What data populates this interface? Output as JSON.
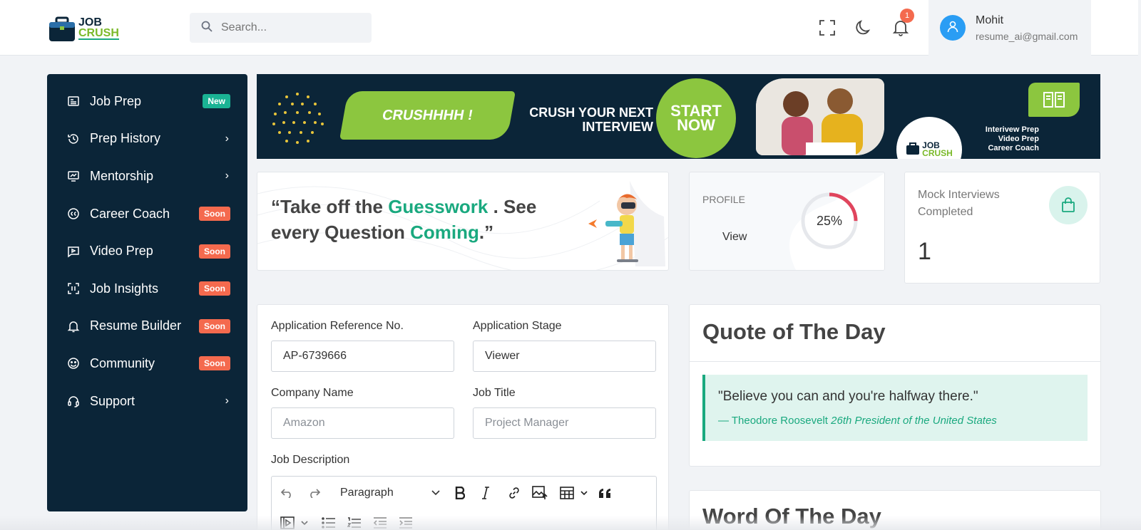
{
  "header": {
    "logo_line1": "JOB",
    "logo_line2": "CRUSH",
    "search_placeholder": "Search...",
    "notification_count": "1",
    "user_name": "Mohit",
    "user_email": "resume_ai@gmail.com"
  },
  "sidebar": {
    "items": [
      {
        "label": "Job Prep",
        "tag": "New"
      },
      {
        "label": "Prep History",
        "chevron": "›"
      },
      {
        "label": "Mentorship",
        "chevron": "›"
      },
      {
        "label": "Career Coach",
        "tag": "Soon"
      },
      {
        "label": "Video Prep",
        "tag": "Soon"
      },
      {
        "label": "Job Insights",
        "tag": "Soon"
      },
      {
        "label": "Resume Builder",
        "tag": "Soon"
      },
      {
        "label": "Community",
        "tag": "Soon"
      },
      {
        "label": "Support",
        "chevron": "›"
      }
    ]
  },
  "banner": {
    "brush_text": "CRUSHHHH !",
    "headline_1": "CRUSH YOUR NEXT",
    "headline_2": "INTERVIEW",
    "cta_1": "START",
    "cta_2": "NOW",
    "logo_1": "JOB",
    "logo_2": "CRUSH",
    "features": [
      "Interivew Prep",
      "Video Prep",
      "Career Coach"
    ]
  },
  "quote_card": {
    "part1": "“Take off the ",
    "highlight1": "Guesswork",
    "part2": " . See every Question ",
    "highlight2": "Coming",
    "part3": ".”"
  },
  "profile": {
    "label": "PROFILE",
    "view": "View",
    "percent_label": "25%",
    "percent": 25
  },
  "mock": {
    "label": "Mock Interviews Completed",
    "value": "1"
  },
  "form": {
    "ref_label": "Application Reference No.",
    "ref_value": "AP-6739666",
    "stage_label": "Application Stage",
    "stage_value": "Viewer",
    "company_label": "Company Name",
    "company_placeholder": "Amazon",
    "title_label": "Job Title",
    "title_placeholder": "Project Manager",
    "desc_label": "Job Description",
    "paragraph_label": "Paragraph"
  },
  "qotd": {
    "title": "Quote of The Day",
    "quote": "\"Believe you can and you're halfway there.\"",
    "author": "— Theodore Roosevelt ",
    "author_title": "26th President of the United States"
  },
  "wotd": {
    "title": "Word Of The Day"
  },
  "colors": {
    "navy": "#0b2538",
    "green": "#1aa97f",
    "lime": "#8cc63f",
    "soon": "#f46a4e",
    "new": "#1ab394"
  }
}
